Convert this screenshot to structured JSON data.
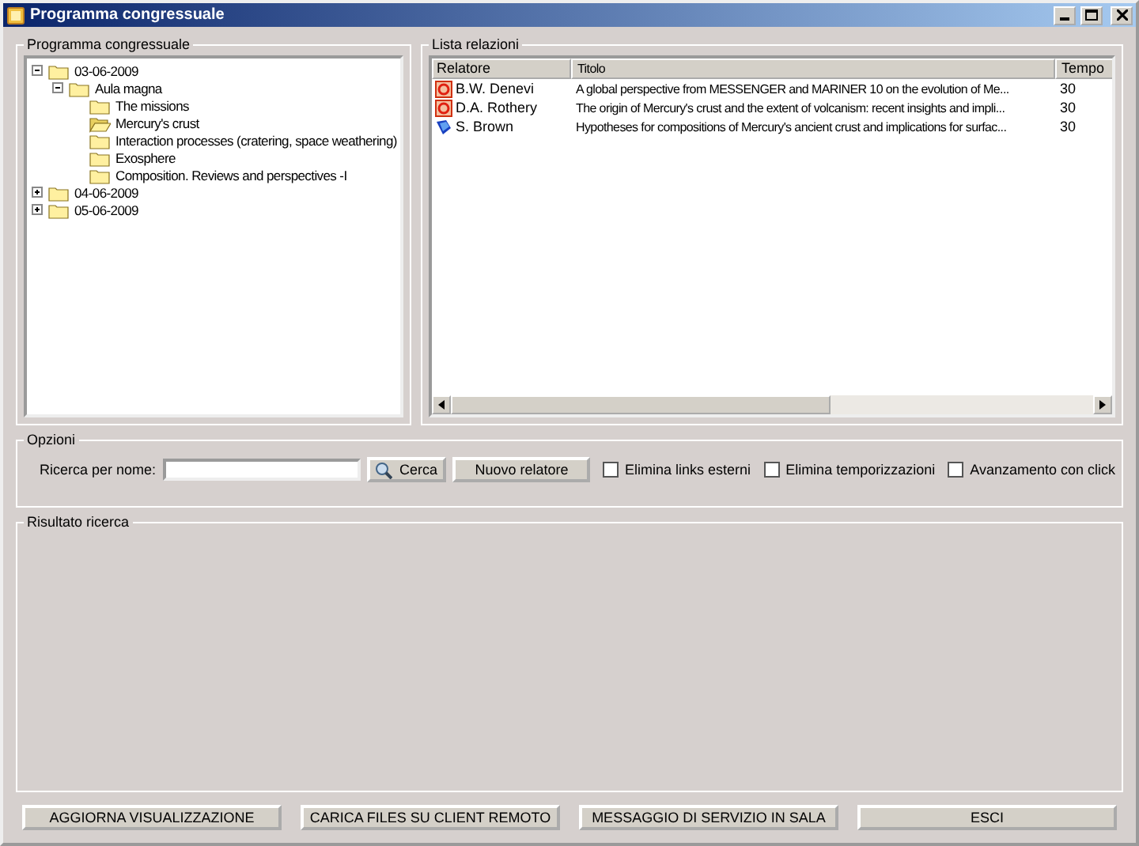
{
  "window": {
    "title": "Programma congressuale"
  },
  "program": {
    "title": "Programma congressuale",
    "tree": [
      {
        "label": "03-06-2009",
        "expanded": true,
        "children": [
          {
            "label": "Aula magna",
            "expanded": true,
            "children": [
              {
                "label": "The missions",
                "open": false
              },
              {
                "label": "Mercury's crust",
                "open": true
              },
              {
                "label": "Interaction processes (cratering, space weathering)",
                "open": false
              },
              {
                "label": "Exosphere",
                "open": false
              },
              {
                "label": "Composition. Reviews and perspectives -I",
                "open": false
              }
            ]
          }
        ]
      },
      {
        "label": "04-06-2009",
        "expanded": false
      },
      {
        "label": "05-06-2009",
        "expanded": false
      }
    ]
  },
  "relations": {
    "title": "Lista relazioni",
    "columns": [
      "Relatore",
      "Titolo",
      "Tempo"
    ],
    "rows": [
      {
        "kind": "slides",
        "speaker": "B.W. Denevi",
        "title": "A global perspective from MESSENGER and MARINER 10 on the evolution of Me...",
        "time": "30"
      },
      {
        "kind": "slides",
        "speaker": "D.A. Rothery",
        "title": "The origin of Mercury's crust and the extent of volcanism: recent insights and impli...",
        "time": "30"
      },
      {
        "kind": "computer",
        "speaker": "S. Brown",
        "title": "Hypotheses for compositions of Mercury's ancient crust and implications for surfac...",
        "time": "30"
      }
    ]
  },
  "options": {
    "title": "Opzioni",
    "search_label": "Ricerca per nome:",
    "search_button": "Cerca",
    "new_button": "Nuovo relatore",
    "checkboxes": [
      {
        "label": "Elimina links esterni",
        "checked": false
      },
      {
        "label": "Elimina temporizzazioni",
        "checked": false
      },
      {
        "label": "Avanzamento con click",
        "checked": false
      }
    ]
  },
  "results": {
    "title": "Risultato ricerca"
  },
  "buttons": [
    "AGGIORNA VISUALIZZAZIONE",
    "CARICA FILES SU CLIENT REMOTO",
    "MESSAGGIO DI SERVIZIO IN SALA",
    "ESCI"
  ]
}
